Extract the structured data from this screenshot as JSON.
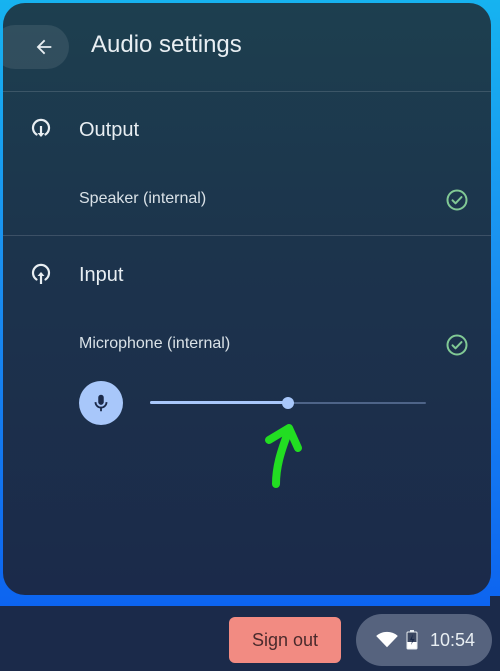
{
  "header": {
    "title": "Audio settings",
    "back_icon": "arrow-left-icon"
  },
  "output": {
    "title": "Output",
    "icon": "output-icon",
    "devices": [
      {
        "label": "Speaker (internal)",
        "selected": true,
        "status_icon": "check-circle-icon"
      }
    ]
  },
  "input": {
    "title": "Input",
    "icon": "input-icon",
    "devices": [
      {
        "label": "Microphone (internal)",
        "selected": true,
        "status_icon": "check-circle-icon"
      }
    ],
    "mic_button_icon": "microphone-icon",
    "gain_percent": 50
  },
  "annotation": {
    "icon": "green-arrow-up-annotation",
    "color": "#22dd22"
  },
  "shelf": {
    "sign_out_label": "Sign out",
    "time": "10:54",
    "wifi_icon": "wifi-icon",
    "battery_icon": "battery-charging-icon"
  },
  "colors": {
    "accent": "#a8c7fa",
    "check": "#81c995",
    "sign_out_bg": "#f28b82",
    "panel_bg": "#1c334c"
  }
}
